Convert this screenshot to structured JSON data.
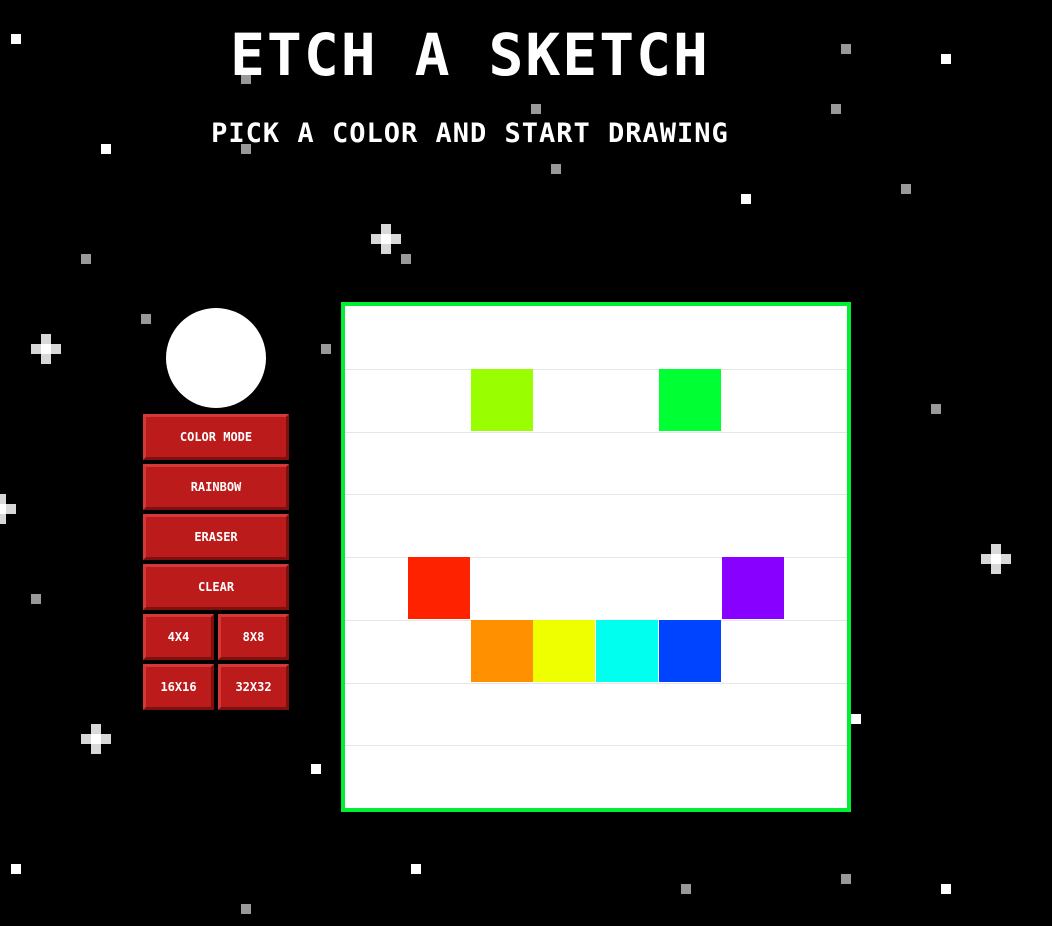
{
  "header": {
    "title": "ETCH A SKETCH",
    "subtitle": "PICK A COLOR AND START DRAWING"
  },
  "controls": {
    "current_color": "#ffffff",
    "buttons": {
      "color_mode": "COLOR MODE",
      "rainbow": "RAINBOW",
      "eraser": "ERASER",
      "clear": "CLEAR",
      "size_4": "4X4",
      "size_8": "8X8",
      "size_16": "16X16",
      "size_32": "32X32"
    },
    "button_color": "#bb1b1b"
  },
  "board": {
    "grid_size": 8,
    "border_color": "#00ee33",
    "background": "#ffffff",
    "painted_cells": [
      {
        "row": 1,
        "col": 2,
        "color": "#99ff00"
      },
      {
        "row": 1,
        "col": 5,
        "color": "#00ff33"
      },
      {
        "row": 4,
        "col": 1,
        "color": "#ff2200"
      },
      {
        "row": 4,
        "col": 6,
        "color": "#8800ff"
      },
      {
        "row": 5,
        "col": 2,
        "color": "#ff9100"
      },
      {
        "row": 5,
        "col": 3,
        "color": "#f0ff00"
      },
      {
        "row": 5,
        "col": 4,
        "color": "#00ffee"
      },
      {
        "row": 5,
        "col": 5,
        "color": "#0044ff"
      }
    ]
  }
}
